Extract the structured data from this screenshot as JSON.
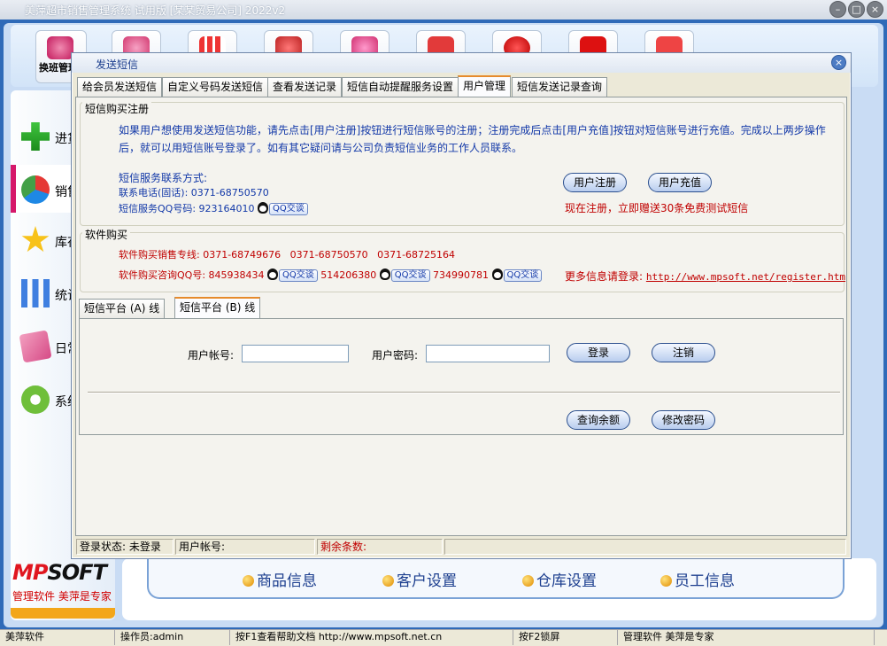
{
  "app": {
    "title": "美萍超市销售管理系统 试用版 [某某贸易公司] 2022v2",
    "toolbar_first_label": "换班管理"
  },
  "sidebar": {
    "items": [
      {
        "label": "进货",
        "icon": "plus-icon"
      },
      {
        "label": "销售",
        "icon": "pie-chart-icon"
      },
      {
        "label": "库存",
        "icon": "star-icon"
      },
      {
        "label": "统计",
        "icon": "bar-chart-icon"
      },
      {
        "label": "日常",
        "icon": "pencil-icon"
      },
      {
        "label": "系统",
        "icon": "gear-icon"
      }
    ],
    "logo": {
      "m": "MP",
      "rest": "SOFT"
    },
    "logo_sub": "管理软件 美萍是专家"
  },
  "quick_links": [
    "商品信息",
    "客户设置",
    "仓库设置",
    "员工信息"
  ],
  "statusbar": {
    "app": "美萍软件",
    "operator": "操作员:admin",
    "help": "按F1查看帮助文档 http://www.mpsoft.net.cn",
    "lock": "按F2锁屏",
    "slogan": "管理软件 美萍是专家"
  },
  "dialog": {
    "title": "发送短信",
    "tabs": [
      "给会员发送短信",
      "自定义号码发送短信",
      "查看发送记录",
      "短信自动提醒服务设置",
      "用户管理",
      "短信发送记录查询"
    ],
    "active_tab": 4,
    "register_group": {
      "title": "短信购买注册",
      "intro_line1": "如果用户想使用发送短信功能，请先点击[用户注册]按钮进行短信账号的注册；注册完成后点击[用户充值]按钮对短信账号进行充值。完成以上两步操作",
      "intro_line2": "后，就可以用短信账号登录了。如有其它疑问请与公司负责短信业务的工作人员联系。",
      "contact_title": "短信服务联系方式:",
      "phone_label": "联系电话(固话): 0371-68750570",
      "qq_label": "短信服务QQ号码: 923164010",
      "qq_chat": "QQ交谈",
      "register_button": "用户注册",
      "recharge_button": "用户充值",
      "promo": "现在注册，立即赠送30条免费测试短信"
    },
    "buy_group": {
      "title": "软件购买",
      "hotline": "软件购买销售专线: 0371-68749676   0371-68750570   0371-68725164",
      "qq_prefix": "软件购买咨询QQ号: 845938434",
      "qq2": "514206380",
      "qq3": "734990781",
      "qq_chat": "QQ交谈",
      "more_info": "更多信息请登录:",
      "url": "http://www.mpsoft.net/register.htm"
    },
    "sub_tabs": [
      "短信平台 (A) 线",
      "短信平台 (B) 线"
    ],
    "active_sub_tab": 1,
    "login": {
      "account_label": "用户帐号:",
      "account_value": "",
      "password_label": "用户密码:",
      "password_value": "",
      "login_button": "登录",
      "logout_button": "注销",
      "balance_button": "查询余额",
      "change_password_button": "修改密码"
    },
    "status": {
      "login_state": "登录状态: 未登录",
      "account": "用户帐号:",
      "remaining": "剩余条数:",
      "extra": ""
    }
  }
}
